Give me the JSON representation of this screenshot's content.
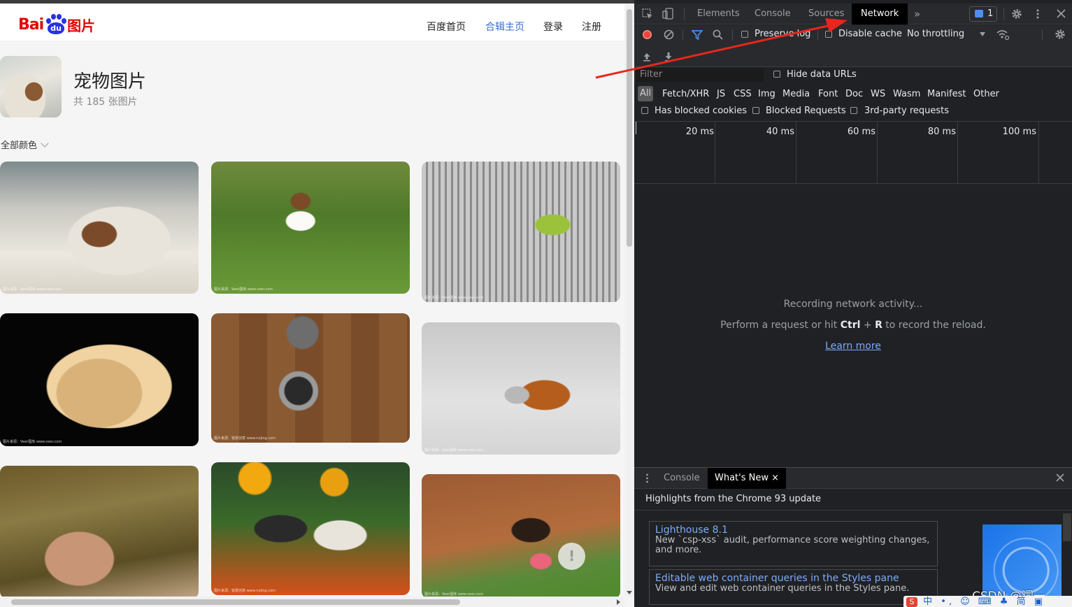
{
  "site": {
    "logo_text_bai": "Bai",
    "logo_text_du": "du",
    "logo_text_tupian": "图片",
    "nav": [
      "百度首页",
      "合辑主页",
      "登录",
      "注册"
    ],
    "nav_active_index": 1
  },
  "album": {
    "title": "宠物图片",
    "count_text": "共 185 张图片",
    "color_filter": "全部颜色"
  },
  "photos": [
    {
      "label": "Puppy sleeping under blanket",
      "watermark": "图片来源：Veer图库 www.veer.com"
    },
    {
      "label": "Puppy running on grass",
      "watermark": "图片来源：Veer图库 www.veer.com"
    },
    {
      "label": "Green parrot on perch",
      "watermark": "图片来源：Veer图库 www.veer.com"
    },
    {
      "label": "Dog nose close-up",
      "watermark": "图片来源：Veer图库 www.veer.com"
    },
    {
      "label": "Cat above bowls of fish",
      "watermark": "图片来源：锐景创意 www.ruijing.com"
    },
    {
      "label": "Cat and golden retriever",
      "watermark": "图片来源：Veer图库 www.veer.com"
    },
    {
      "label": "Hand on grass",
      "watermark": ""
    },
    {
      "label": "Bulldogs in Halloween hats",
      "watermark": "图片来源：锐景创意 www.ruijing.com"
    },
    {
      "label": "Dog with tongue out",
      "watermark": "图片来源：Veer图库 www.veer.com"
    }
  ],
  "feedback_glyph": "!",
  "devtools": {
    "tabs": [
      "Elements",
      "Console",
      "Sources",
      "Network"
    ],
    "active_tab": "Network",
    "more_tabs": "»",
    "issues_count": "1",
    "toolbar": {
      "preserve_log": "Preserve log",
      "disable_cache": "Disable cache",
      "throttling": "No throttling"
    },
    "filter": {
      "placeholder": "Filter",
      "hide_data_urls": "Hide data URLs",
      "types": [
        "All",
        "Fetch/XHR",
        "JS",
        "CSS",
        "Img",
        "Media",
        "Font",
        "Doc",
        "WS",
        "Wasm",
        "Manifest",
        "Other"
      ],
      "has_blocked_cookies": "Has blocked cookies",
      "blocked_requests": "Blocked Requests",
      "third_party": "3rd-party requests"
    },
    "timeline_ticks": [
      "20 ms",
      "40 ms",
      "60 ms",
      "80 ms",
      "100 ms"
    ],
    "empty": {
      "line1": "Recording network activity...",
      "line2_pre": "Perform a request or hit ",
      "line2_key1": "Ctrl",
      "line2_plus": " + ",
      "line2_key2": "R",
      "line2_post": " to record the reload.",
      "learn_more": "Learn more"
    },
    "drawer": {
      "tabs": [
        "Console",
        "What's New"
      ],
      "active_tab": "What's New",
      "close_glyph": "×",
      "headline": "Highlights from the Chrome 93 update",
      "cards": [
        {
          "title": "Lighthouse 8.1",
          "desc": "New `csp-xss` audit, performance score weighting changes, and more."
        },
        {
          "title": "Editable web container queries in the Styles pane",
          "desc": "View and edit web container queries in the Styles pane."
        }
      ]
    }
  },
  "overlay": {
    "csdn_watermark": "CSDN @词一",
    "ime_text": "中 •, ☺ ⌨ ♣ 简 ▣",
    "ime_logo": "S",
    "arrow_color": "#e8261d"
  }
}
